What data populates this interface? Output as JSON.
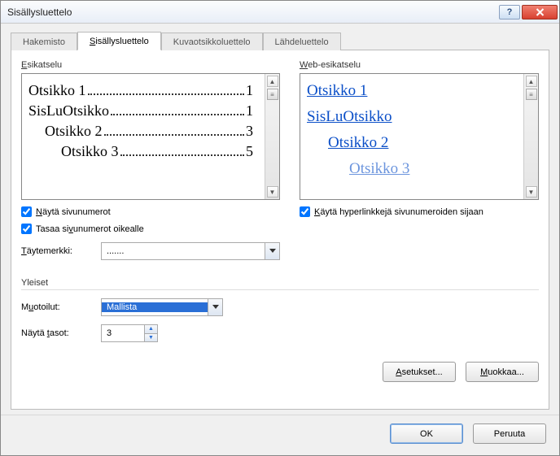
{
  "window": {
    "title": "Sisällysluettelo"
  },
  "tabs": {
    "hakemisto": "Hakemisto",
    "active": "Sisällysluettelo",
    "kuva": "Kuvaotsikkoluettelo",
    "lahde": "Lähdeluettelo"
  },
  "preview": {
    "label": "Esikatselu",
    "r1_txt": "Otsikko 1",
    "r1_pg": "1",
    "r2_txt": "SisLuOtsikko",
    "r2_pg": "1",
    "r3_txt": "Otsikko 2",
    "r3_pg": "3",
    "r4_txt": "Otsikko 3",
    "r4_pg": "5"
  },
  "web": {
    "label": "Web-esikatselu",
    "l1": "Otsikko 1",
    "l2": "SisLuOtsikko",
    "l3": "Otsikko 2",
    "l4": "Otsikko 3"
  },
  "checks": {
    "show_pg_u": "N",
    "show_pg_rest": "äytä sivunumerot",
    "align_pg_u": "v",
    "align_pg_pre": "Tasaa si",
    "align_pg_rest": "unumerot oikealle",
    "hyper_u": "K",
    "hyper_rest": "äytä hyperlinkkejä sivunumeroiden sijaan"
  },
  "leader": {
    "label_u": "T",
    "label_rest": "äytemerkki:",
    "value": "......."
  },
  "general": {
    "group": "Yleiset",
    "fmt_label_u": "u",
    "fmt_label_pre": "M",
    "fmt_label_rest": "otoilut:",
    "fmt_value": "Mallista",
    "lvl_label_u": "t",
    "lvl_label_pre": "Näytä ",
    "lvl_label_rest": "asot:",
    "lvl_value": "3"
  },
  "buttons": {
    "options_u": "A",
    "options_rest": "setukset...",
    "modify_u": "M",
    "modify_rest": "uokkaa...",
    "ok": "OK",
    "cancel": "Peruuta"
  }
}
